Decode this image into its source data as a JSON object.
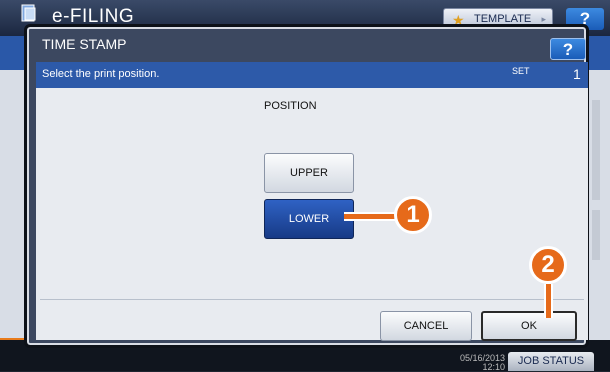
{
  "app": {
    "title": "e-FILING",
    "template_label": "TEMPLATE",
    "help_label": "?",
    "job_status_label": "JOB STATUS",
    "clock_date": "05/16/2013",
    "clock_time": "12:10"
  },
  "dialog": {
    "title": "TIME STAMP",
    "help_label": "?",
    "instruction": "Select the print position.",
    "set_label": "SET",
    "set_count": "1",
    "section_label": "POSITION",
    "options": [
      {
        "label": "UPPER",
        "selected": false
      },
      {
        "label": "LOWER",
        "selected": true
      }
    ],
    "cancel_label": "CANCEL",
    "ok_label": "OK"
  },
  "callouts": [
    "1",
    "2"
  ],
  "colors": {
    "accent_blue": "#2d5aa9",
    "selected_button": "#1f4aa0",
    "callout_orange": "#e66a1a"
  }
}
